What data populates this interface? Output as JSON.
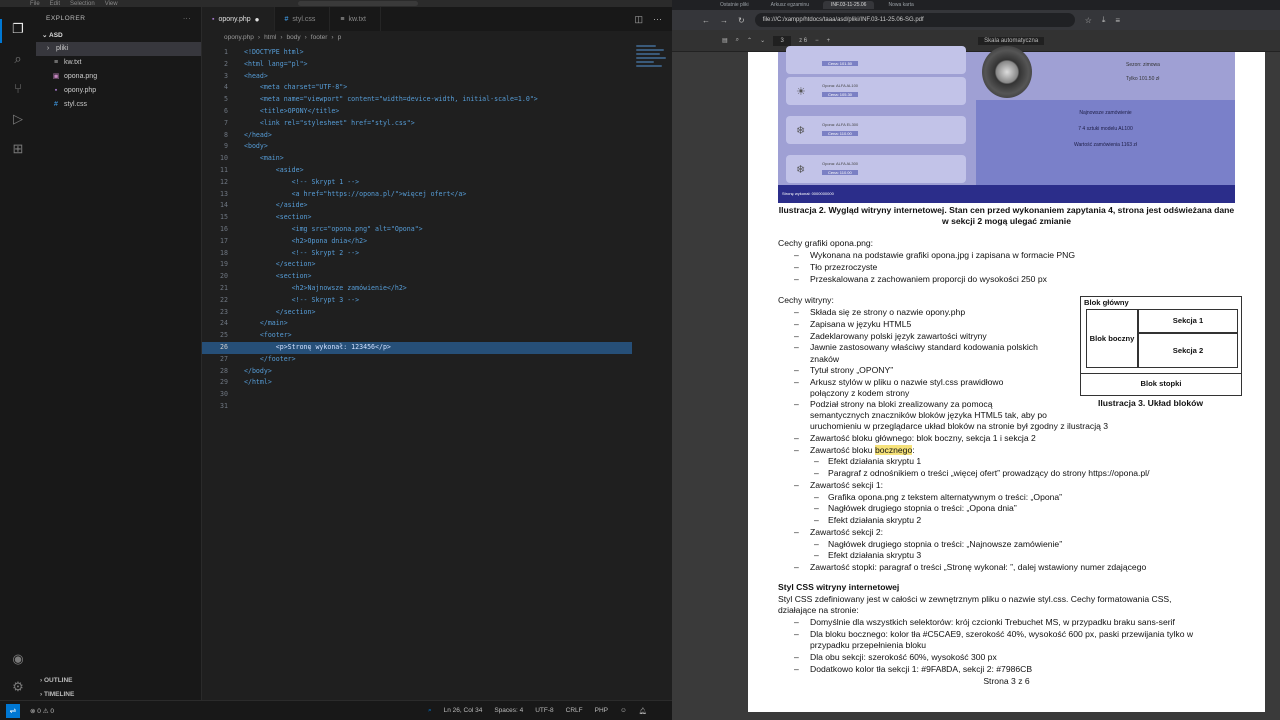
{
  "vscode": {
    "menu": [
      "File",
      "Edit",
      "Selection",
      "View"
    ],
    "explorer_title": "EXPLORER",
    "explorer_more": "···",
    "folder": "ASD",
    "files": [
      {
        "name": "pliki",
        "icon": "folder"
      },
      {
        "name": "kw.txt",
        "icon": "txt"
      },
      {
        "name": "opona.png",
        "icon": "png"
      },
      {
        "name": "opony.php",
        "icon": "php"
      },
      {
        "name": "styl.css",
        "icon": "css"
      }
    ],
    "outline": "OUTLINE",
    "timeline": "TIMELINE",
    "tabs": [
      {
        "label": "opony.php",
        "modified": true
      },
      {
        "label": "styl.css",
        "modified": false
      },
      {
        "label": "kw.txt",
        "modified": false
      }
    ],
    "breadcrumb": [
      "opony.php",
      "html",
      "body",
      "footer",
      "p"
    ],
    "code_lines": [
      "<!DOCTYPE html>",
      "<html lang=\"pl\">",
      "<head>",
      "    <meta charset=\"UTF-8\">",
      "    <meta name=\"viewport\" content=\"width=device-width, initial-scale=1.0\">",
      "    <title>OPONY</title>",
      "    <link rel=\"stylesheet\" href=\"styl.css\">",
      "</head>",
      "<body>",
      "    <main>",
      "        <aside>",
      "            <!-- Skrypt 1 -->",
      "            <a href=\"https://opona.pl/\">więcej ofert</a>",
      "        </aside>",
      "        <section>",
      "            <img src=\"opona.png\" alt=\"Opona\">",
      "            <h2>Opona dnia</h2>",
      "            <!-- Skrypt 2 -->",
      "        </section>",
      "        <section>",
      "            <h2>Najnowsze zamówienie</h2>",
      "            <!-- Skrypt 3 -->",
      "        </section>",
      "    </main>",
      "    <footer>",
      "        <p>Stronę wykonał: 123456</p>",
      "    </footer>",
      "</body>",
      "</html>",
      "",
      ""
    ],
    "current_line": 26,
    "status": {
      "errors": "0",
      "warnings": "0",
      "position": "Ln 26, Col 34",
      "spaces": "Spaces: 4",
      "encoding": "UTF-8",
      "eol": "CRLF",
      "language": "PHP"
    }
  },
  "browser": {
    "tabs": [
      "Ostatnie pliki",
      "Arkusz egzaminu",
      "INF.03-11-25.06",
      "Nowa karta"
    ],
    "url": "file:///C:/xampp/htdocs/taaa/asd/pliki/INF.03-11-25.06-SG.pdf",
    "pdf_page_input": "3",
    "pdf_page_total": "z 6",
    "pdf_zoom": "Skala automatyczna"
  },
  "pdf": {
    "ill2": {
      "cards": [
        {
          "name": "",
          "price": "Cena: 101.50",
          "icon": "sun-icon"
        },
        {
          "name": "Opona: ALFA AL100",
          "price": "Cena: 105.30",
          "icon": "sun-icon"
        },
        {
          "name": "Opona: ALFA EL300",
          "price": "Cena: 110.00",
          "icon": "snowflake-icon"
        },
        {
          "name": "Opona: ALFA AL300",
          "price": "Cena: 110.00",
          "icon": "snowflake-icon"
        }
      ],
      "s1_lines": [
        "Sezon: zimowa",
        "Tylko 101.50 zł"
      ],
      "s2_lines": [
        "Najnowsze zamówienie",
        "7 4 sztuki modelu AL100",
        "Wartość zamówienia 1163 zł"
      ],
      "footer": "Stronę wykonał: 0000000000"
    },
    "caption2": "Ilustracja 2. Wygląd witryny internetowej. Stan cen przed wykonaniem zapytania 4, strona jest odświeżana dane w sekcji 2 mogą ulegać zmianie",
    "grafika_head": "Cechy grafiki opona.png:",
    "grafika_items": [
      "Wykonana na podstawie grafiki opona.jpg i zapisana w formacie PNG",
      "Tło przezroczyste",
      "Przeskalowana z zachowaniem proporcji do wysokości 250 px"
    ],
    "witryna_head": "Cechy witryny:",
    "witryna_items": [
      "Składa się ze strony o nazwie opony.php",
      "Zapisana w języku HTML5",
      "Zadeklarowany polski język zawartości witryny",
      "Jawnie zastosowany właściwy standard kodowania polskich",
      "znaków",
      "Tytuł strony „OPONY”",
      "Arkusz stylów w pliku o nazwie styl.css prawidłowo",
      "połączony z kodem strony",
      "Podział strony na bloki zrealizowany za pomocą",
      "semantycznych znaczników bloków języka HTML5 tak, aby po",
      "uruchomieniu w przeglądarce układ bloków na stronie był zgodny z ilustracją 3",
      "Zawartość bloku głównego: blok boczny, sekcja 1 i sekcja 2"
    ],
    "bocznego_pre": "Zawartość bloku ",
    "bocznego_hl": "bocznego",
    "bocznego_post": ":",
    "boczny_sub": [
      "Efekt działania skryptu 1",
      "Paragraf z odnośnikiem o treści „więcej ofert” prowadzący do strony https://opona.pl/"
    ],
    "sekcja1": "Zawartość sekcji 1:",
    "sekcja1_sub": [
      "Grafika opona.png z tekstem alternatywnym o treści: „Opona”",
      "Nagłówek drugiego stopnia o treści: „Opona dnia”",
      "Efekt działania skryptu 2"
    ],
    "sekcja2": "Zawartość sekcji 2:",
    "sekcja2_sub": [
      "Nagłówek drugiego stopnia o treści: „Najnowsze zamówienie”",
      "Efekt działania skryptu 3"
    ],
    "stopka": "Zawartość stopki: paragraf o treści „Stronę wykonał: ”, dalej wstawiony numer zdającego",
    "blocks": {
      "main": "Blok główny",
      "side": "Blok boczny",
      "sec1": "Sekcja 1",
      "sec2": "Sekcja 2",
      "footer": "Blok stopki",
      "caption": "Ilustracja 3. Układ bloków"
    },
    "css_head": "Styl CSS witryny internetowej",
    "css_intro": [
      "Styl CSS zdefiniowany jest w całości w zewnętrznym pliku o nazwie styl.css. Cechy formatowania CSS,",
      "działające na stronie:"
    ],
    "css_items": [
      "Domyślnie dla wszystkich selektorów: krój czcionki Trebuchet MS, w przypadku braku sans-serif",
      "Dla bloku bocznego: kolor tła #C5CAE9, szerokość 40%, wysokość 600 px, paski przewijania tylko w",
      "przypadku przepełnienia bloku",
      "Dla obu sekcji: szerokość 60%, wysokość 300 px",
      "Dodatkowo kolor tła sekcji 1: #9FA8DA, sekcji 2: #7986CB"
    ],
    "page_footer": "Strona 3 z 6"
  }
}
